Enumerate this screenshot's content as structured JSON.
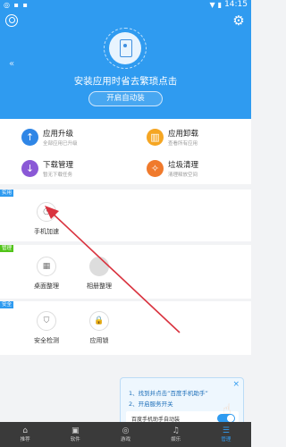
{
  "status_bar": {
    "left": "◎ ▪ ▪",
    "time": "14:15",
    "icons": [
      "signal-icon",
      "battery-icon"
    ]
  },
  "header": {
    "title": "安装应用时省去繁琐点击",
    "button_label": "开启自动装",
    "icons": {
      "avatar": "person-circle-icon",
      "settings": "gear-icon",
      "back": "chevron-left-icon"
    }
  },
  "top_grid": [
    {
      "title": "应用升级",
      "subtitle": "全部应用已升级",
      "icon": "arrow-up-icon",
      "color": "#2f86e6"
    },
    {
      "title": "应用卸载",
      "subtitle": "查看所有应用",
      "icon": "trash-icon",
      "color": "#f5a623"
    },
    {
      "title": "下载管理",
      "subtitle": "暂无下载任务",
      "icon": "arrow-down-icon",
      "color": "#8a58d6"
    },
    {
      "title": "垃圾清理",
      "subtitle": "清理释放空间",
      "icon": "broom-icon",
      "color": "#f07a2c"
    }
  ],
  "sections": [
    {
      "tag": "实用",
      "tag_color": "#2f9bf0",
      "tools": [
        {
          "label": "手机加速",
          "icon": "speedometer-icon"
        }
      ]
    },
    {
      "tag": "管理",
      "tag_color": "#52c41a",
      "tools": [
        {
          "label": "桌面整理",
          "icon": "desktop-icon"
        },
        {
          "label": "相册整理",
          "icon": "album-icon"
        }
      ]
    },
    {
      "tag": "安全",
      "tag_color": "#2f9bf0",
      "tools": [
        {
          "label": "安全检测",
          "icon": "shield-icon"
        },
        {
          "label": "应用锁",
          "icon": "lock-icon"
        }
      ]
    }
  ],
  "tip": {
    "line1": "1、找到并点击“百度手机助手”",
    "line2": "2、开启服务开关",
    "toggle_label": "百度手机助手自动装",
    "toggle_on": true,
    "close": "×"
  },
  "bottom_nav": [
    {
      "label": "推荐",
      "icon": "home-icon",
      "active": false
    },
    {
      "label": "软件",
      "icon": "grid-icon",
      "active": false
    },
    {
      "label": "游戏",
      "icon": "gamepad-icon",
      "active": false
    },
    {
      "label": "娱乐",
      "icon": "entertainment-icon",
      "active": false
    },
    {
      "label": "管理",
      "icon": "manage-icon",
      "active": true
    }
  ],
  "colors": {
    "primary": "#2f9bf0",
    "annotation_arrow": "#d9333f"
  }
}
